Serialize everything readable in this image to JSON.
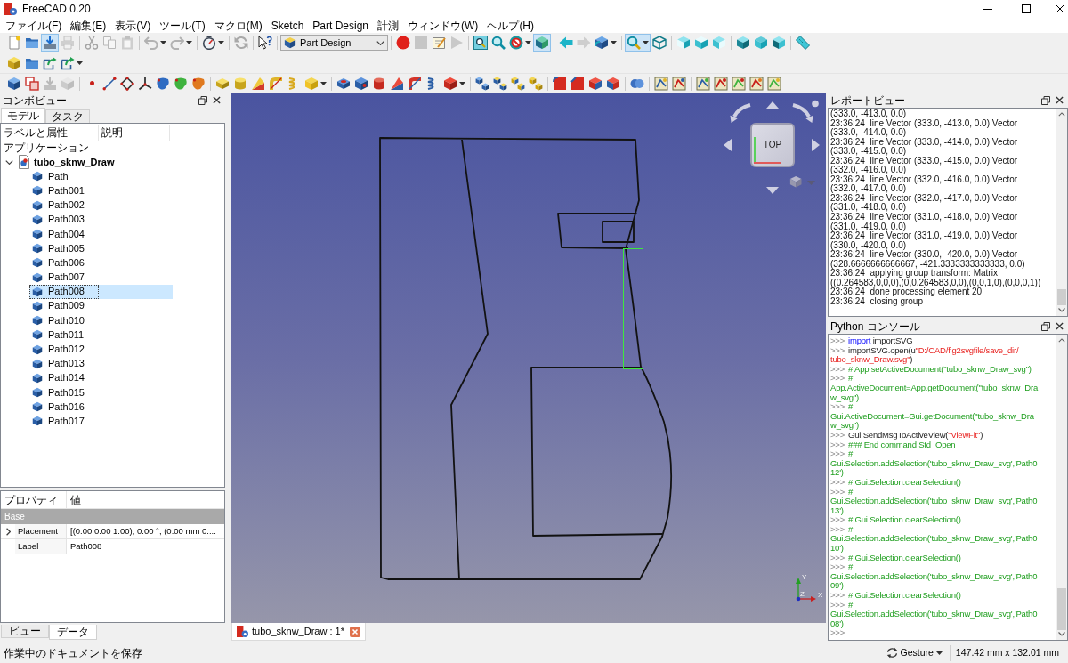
{
  "window": {
    "title": "FreeCAD 0.20"
  },
  "menu": [
    "ファイル(F)",
    "編集(E)",
    "表示(V)",
    "ツール(T)",
    "マクロ(M)",
    "Sketch",
    "Part Design",
    "計測",
    "ウィンドウ(W)",
    "ヘルプ(H)"
  ],
  "toolbars": [
    [
      [
        {
          "kind": "button",
          "pressed": false,
          "disabled": false
        },
        {
          "kind": "button",
          "pressed": false,
          "disabled": false
        },
        {
          "kind": "button",
          "pressed": true,
          "disabled": false
        },
        {
          "kind": "button",
          "pressed": false,
          "disabled": true
        }
      ],
      [
        {
          "kind": "button",
          "pressed": false,
          "disabled": true
        },
        {
          "kind": "button",
          "pressed": false,
          "disabled": true
        },
        {
          "kind": "button",
          "pressed": false,
          "disabled": true
        }
      ],
      [
        {
          "kind": "menu",
          "pressed": false,
          "disabled": true
        },
        {
          "kind": "menu",
          "pressed": false,
          "disabled": true
        }
      ],
      [
        {
          "kind": "menu",
          "pressed": false,
          "disabled": false
        }
      ],
      [
        {
          "kind": "button",
          "pressed": false,
          "disabled": true
        }
      ],
      [
        {
          "kind": "button",
          "pressed": false,
          "disabled": false
        }
      ],
      [
        {
          "kind": "combo",
          "value": "Part Design",
          "pressed": false,
          "disabled": false
        }
      ],
      [
        {
          "kind": "button",
          "pressed": false,
          "disabled": false
        },
        {
          "kind": "button",
          "pressed": false,
          "disabled": true
        },
        {
          "kind": "button",
          "pressed": false,
          "disabled": false
        },
        {
          "kind": "button",
          "pressed": false,
          "disabled": true
        }
      ],
      [
        {
          "kind": "button",
          "pressed": false,
          "disabled": false
        },
        {
          "kind": "button",
          "pressed": false,
          "disabled": false
        },
        {
          "kind": "menu",
          "pressed": false,
          "disabled": false
        },
        {
          "kind": "button",
          "pressed": true,
          "disabled": false
        }
      ],
      [
        {
          "kind": "button",
          "pressed": false,
          "disabled": false
        },
        {
          "kind": "button",
          "pressed": false,
          "disabled": true
        },
        {
          "kind": "menu",
          "pressed": false,
          "disabled": false
        }
      ],
      [
        {
          "kind": "menu",
          "pressed": true,
          "disabled": false
        },
        {
          "kind": "button",
          "pressed": false,
          "disabled": false
        }
      ],
      [
        {
          "kind": "button",
          "pressed": false,
          "disabled": false
        },
        {
          "kind": "button",
          "pressed": false,
          "disabled": false
        },
        {
          "kind": "button",
          "pressed": false,
          "disabled": false
        }
      ],
      [
        {
          "kind": "button",
          "pressed": false,
          "disabled": false
        },
        {
          "kind": "button",
          "pressed": false,
          "disabled": false
        },
        {
          "kind": "button",
          "pressed": false,
          "disabled": false
        }
      ],
      [
        {
          "kind": "button",
          "pressed": false,
          "disabled": false
        }
      ]
    ],
    [
      [
        {
          "kind": "button",
          "pressed": false,
          "disabled": false
        },
        {
          "kind": "button",
          "pressed": false,
          "disabled": false
        },
        {
          "kind": "button",
          "pressed": false,
          "disabled": false
        },
        {
          "kind": "menu",
          "pressed": false,
          "disabled": false
        }
      ]
    ],
    [
      [
        {
          "kind": "button",
          "pressed": false,
          "disabled": false
        },
        {
          "kind": "button",
          "pressed": false,
          "disabled": false
        },
        {
          "kind": "button",
          "pressed": false,
          "disabled": true
        },
        {
          "kind": "button",
          "pressed": false,
          "disabled": true
        }
      ],
      [
        {
          "kind": "button",
          "pressed": false,
          "disabled": false
        },
        {
          "kind": "button",
          "pressed": false,
          "disabled": false
        },
        {
          "kind": "button",
          "pressed": false,
          "disabled": false
        },
        {
          "kind": "button",
          "pressed": false,
          "disabled": false
        },
        {
          "kind": "button",
          "pressed": false,
          "disabled": false
        },
        {
          "kind": "button",
          "pressed": false,
          "disabled": false
        },
        {
          "kind": "button",
          "pressed": false,
          "disabled": false
        }
      ],
      [
        {
          "kind": "button",
          "pressed": false,
          "disabled": false
        },
        {
          "kind": "button",
          "pressed": false,
          "disabled": false
        },
        {
          "kind": "button",
          "pressed": false,
          "disabled": false
        },
        {
          "kind": "button",
          "pressed": false,
          "disabled": false
        },
        {
          "kind": "button",
          "pressed": false,
          "disabled": false
        },
        {
          "kind": "menu",
          "pressed": false,
          "disabled": false
        }
      ],
      [
        {
          "kind": "button",
          "pressed": false,
          "disabled": false
        },
        {
          "kind": "button",
          "pressed": false,
          "disabled": false
        },
        {
          "kind": "button",
          "pressed": false,
          "disabled": false
        },
        {
          "kind": "button",
          "pressed": false,
          "disabled": false
        },
        {
          "kind": "button",
          "pressed": false,
          "disabled": false
        },
        {
          "kind": "button",
          "pressed": false,
          "disabled": false
        },
        {
          "kind": "menu",
          "pressed": false,
          "disabled": false
        }
      ],
      [
        {
          "kind": "button",
          "pressed": false,
          "disabled": false
        },
        {
          "kind": "button",
          "pressed": false,
          "disabled": false
        },
        {
          "kind": "button",
          "pressed": false,
          "disabled": false
        },
        {
          "kind": "button",
          "pressed": false,
          "disabled": false
        }
      ],
      [
        {
          "kind": "button",
          "pressed": false,
          "disabled": false
        },
        {
          "kind": "button",
          "pressed": false,
          "disabled": false
        },
        {
          "kind": "button",
          "pressed": false,
          "disabled": false
        },
        {
          "kind": "button",
          "pressed": false,
          "disabled": false
        }
      ],
      [
        {
          "kind": "button",
          "pressed": false,
          "disabled": false
        }
      ],
      [
        {
          "kind": "button",
          "pressed": false,
          "disabled": false
        },
        {
          "kind": "button",
          "pressed": false,
          "disabled": false
        }
      ],
      [
        {
          "kind": "button",
          "pressed": false,
          "disabled": false
        },
        {
          "kind": "button",
          "pressed": false,
          "disabled": false
        },
        {
          "kind": "button",
          "pressed": false,
          "disabled": false
        },
        {
          "kind": "button",
          "pressed": false,
          "disabled": false
        },
        {
          "kind": "button",
          "pressed": false,
          "disabled": false
        }
      ]
    ]
  ],
  "combo_view": {
    "title": "コンボビュー",
    "tabs": [
      {
        "label": "モデル",
        "selected": true
      },
      {
        "label": "タスク",
        "selected": false
      }
    ],
    "tree": {
      "columns": [
        "ラベルと属性",
        "説明"
      ],
      "section": "アプリケーション",
      "document": {
        "label": "tubo_sknw_Draw",
        "expanded": true,
        "children": [
          {
            "label": "Path",
            "selected": false
          },
          {
            "label": "Path001",
            "selected": false
          },
          {
            "label": "Path002",
            "selected": false
          },
          {
            "label": "Path003",
            "selected": false
          },
          {
            "label": "Path004",
            "selected": false
          },
          {
            "label": "Path005",
            "selected": false
          },
          {
            "label": "Path006",
            "selected": false
          },
          {
            "label": "Path007",
            "selected": false
          },
          {
            "label": "Path008",
            "selected": true
          },
          {
            "label": "Path009",
            "selected": false
          },
          {
            "label": "Path010",
            "selected": false
          },
          {
            "label": "Path011",
            "selected": false
          },
          {
            "label": "Path012",
            "selected": false
          },
          {
            "label": "Path013",
            "selected": false
          },
          {
            "label": "Path014",
            "selected": false
          },
          {
            "label": "Path015",
            "selected": false
          },
          {
            "label": "Path016",
            "selected": false
          },
          {
            "label": "Path017",
            "selected": false
          }
        ]
      }
    },
    "properties": {
      "columns": [
        "プロパティ",
        "値"
      ],
      "group": "Base",
      "rows": [
        {
          "kind": "compound",
          "name": "Placement",
          "value": "[(0.00 0.00 1.00); 0.00 °; (0.00 mm 0...."
        },
        {
          "kind": "plain",
          "name": "Label",
          "value": "Path008"
        }
      ]
    },
    "bottom_tabs": [
      {
        "label": "ビュー",
        "selected": false
      },
      {
        "label": "データ",
        "selected": true
      }
    ]
  },
  "viewer": {
    "nav_cube": {
      "face": "TOP"
    },
    "axes": {
      "y": "Y",
      "z": "Z",
      "x": "X"
    },
    "document_tab": "tubo_sknw_Draw : 1*"
  },
  "report_view": {
    "title": "レポートビュー",
    "lines": [
      "(333.0, -413.0, 0.0)",
      "23:36:24  line Vector (333.0, -413.0, 0.0) Vector",
      "(333.0, -414.0, 0.0)",
      "23:36:24  line Vector (333.0, -414.0, 0.0) Vector",
      "(333.0, -415.0, 0.0)",
      "23:36:24  line Vector (333.0, -415.0, 0.0) Vector",
      "(332.0, -416.0, 0.0)",
      "23:36:24  line Vector (332.0, -416.0, 0.0) Vector",
      "(332.0, -417.0, 0.0)",
      "23:36:24  line Vector (332.0, -417.0, 0.0) Vector",
      "(331.0, -418.0, 0.0)",
      "23:36:24  line Vector (331.0, -418.0, 0.0) Vector",
      "(331.0, -419.0, 0.0)",
      "23:36:24  line Vector (331.0, -419.0, 0.0) Vector",
      "(330.0, -420.0, 0.0)",
      "23:36:24  line Vector (330.0, -420.0, 0.0) Vector",
      "(328.6666666666667, -421.3333333333333, 0.0)",
      "23:36:24  applying group transform: Matrix",
      "((0.264583,0,0,0),(0,0.264583,0,0),(0,0,1,0),(0,0,0,1))",
      "23:36:24  done processing element 20",
      "23:36:24  closing group"
    ]
  },
  "python_console": {
    "title": "Python コンソール",
    "lines": [
      {
        "parts": [
          {
            "kind": "prompt",
            "text": ">>>"
          },
          {
            "kind": "keyword",
            "text": "import"
          },
          {
            "kind": "plain",
            "text": " importSVG"
          }
        ]
      },
      {
        "parts": [
          {
            "kind": "prompt",
            "text": ">>>"
          },
          {
            "kind": "plain",
            "text": "importSVG.open(u"
          },
          {
            "kind": "string",
            "text": "\"D:/CAD/fig2svgfile/save_dir/"
          }
        ]
      },
      {
        "parts": [
          {
            "kind": "string",
            "text": "tubo_sknw_Draw.svg\""
          },
          {
            "kind": "plain",
            "text": ")"
          }
        ]
      },
      {
        "parts": [
          {
            "kind": "prompt",
            "text": ">>>"
          },
          {
            "kind": "comment",
            "text": "# App.setActiveDocument(\"tubo_sknw_Draw_svg\")"
          }
        ]
      },
      {
        "parts": [
          {
            "kind": "prompt",
            "text": ">>>"
          },
          {
            "kind": "comment",
            "text": "#"
          }
        ]
      },
      {
        "parts": [
          {
            "kind": "comment",
            "text": "App.ActiveDocument=App.getDocument(\"tubo_sknw_Dra"
          }
        ]
      },
      {
        "parts": [
          {
            "kind": "comment",
            "text": "w_svg\")"
          }
        ]
      },
      {
        "parts": [
          {
            "kind": "prompt",
            "text": ">>>"
          },
          {
            "kind": "comment",
            "text": "#"
          }
        ]
      },
      {
        "parts": [
          {
            "kind": "comment",
            "text": "Gui.ActiveDocument=Gui.getDocument(\"tubo_sknw_Dra"
          }
        ]
      },
      {
        "parts": [
          {
            "kind": "comment",
            "text": "w_svg\")"
          }
        ]
      },
      {
        "parts": [
          {
            "kind": "prompt",
            "text": ">>>"
          },
          {
            "kind": "plain",
            "text": "Gui.SendMsgToActiveView("
          },
          {
            "kind": "string",
            "text": "\"ViewFit\""
          },
          {
            "kind": "plain",
            "text": ")"
          }
        ]
      },
      {
        "parts": [
          {
            "kind": "prompt",
            "text": ">>>"
          },
          {
            "kind": "comment",
            "text": "### End command Std_Open"
          }
        ]
      },
      {
        "parts": [
          {
            "kind": "prompt",
            "text": ">>>"
          },
          {
            "kind": "comment",
            "text": "#"
          }
        ]
      },
      {
        "parts": [
          {
            "kind": "comment",
            "text": "Gui.Selection.addSelection('tubo_sknw_Draw_svg','Path0"
          }
        ]
      },
      {
        "parts": [
          {
            "kind": "comment",
            "text": "12')"
          }
        ]
      },
      {
        "parts": [
          {
            "kind": "prompt",
            "text": ">>>"
          },
          {
            "kind": "comment",
            "text": "# Gui.Selection.clearSelection()"
          }
        ]
      },
      {
        "parts": [
          {
            "kind": "prompt",
            "text": ">>>"
          },
          {
            "kind": "comment",
            "text": "#"
          }
        ]
      },
      {
        "parts": [
          {
            "kind": "comment",
            "text": "Gui.Selection.addSelection('tubo_sknw_Draw_svg','Path0"
          }
        ]
      },
      {
        "parts": [
          {
            "kind": "comment",
            "text": "13')"
          }
        ]
      },
      {
        "parts": [
          {
            "kind": "prompt",
            "text": ">>>"
          },
          {
            "kind": "comment",
            "text": "# Gui.Selection.clearSelection()"
          }
        ]
      },
      {
        "parts": [
          {
            "kind": "prompt",
            "text": ">>>"
          },
          {
            "kind": "comment",
            "text": "#"
          }
        ]
      },
      {
        "parts": [
          {
            "kind": "comment",
            "text": "Gui.Selection.addSelection('tubo_sknw_Draw_svg','Path0"
          }
        ]
      },
      {
        "parts": [
          {
            "kind": "comment",
            "text": "10')"
          }
        ]
      },
      {
        "parts": [
          {
            "kind": "prompt",
            "text": ">>>"
          },
          {
            "kind": "comment",
            "text": "# Gui.Selection.clearSelection()"
          }
        ]
      },
      {
        "parts": [
          {
            "kind": "prompt",
            "text": ">>>"
          },
          {
            "kind": "comment",
            "text": "#"
          }
        ]
      },
      {
        "parts": [
          {
            "kind": "comment",
            "text": "Gui.Selection.addSelection('tubo_sknw_Draw_svg','Path0"
          }
        ]
      },
      {
        "parts": [
          {
            "kind": "comment",
            "text": "09')"
          }
        ]
      },
      {
        "parts": [
          {
            "kind": "prompt",
            "text": ">>>"
          },
          {
            "kind": "comment",
            "text": "# Gui.Selection.clearSelection()"
          }
        ]
      },
      {
        "parts": [
          {
            "kind": "prompt",
            "text": ">>>"
          },
          {
            "kind": "comment",
            "text": "#"
          }
        ]
      },
      {
        "parts": [
          {
            "kind": "comment",
            "text": "Gui.Selection.addSelection('tubo_sknw_Draw_svg','Path0"
          }
        ]
      },
      {
        "parts": [
          {
            "kind": "comment",
            "text": "08')"
          }
        ]
      },
      {
        "parts": [
          {
            "kind": "prompt",
            "text": ">>>"
          }
        ]
      }
    ]
  },
  "status_bar": {
    "message": "作業中のドキュメントを保存",
    "navigation": "Gesture",
    "dimensions": "147.42 mm x 132.01 mm"
  }
}
